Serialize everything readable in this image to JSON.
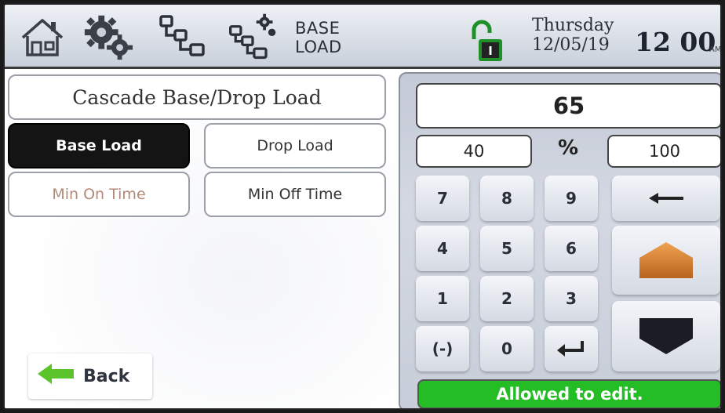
{
  "header": {
    "screen_title_line1": "BASE",
    "screen_title_line2": "LOAD",
    "day": "Thursday",
    "date": "12/05/19",
    "time": "12 00",
    "ampm": "AM",
    "icons": [
      "home-icon",
      "settings-gears-icon",
      "cascade-icon",
      "cascade-settings-icon",
      "unlocked-padlock-icon"
    ]
  },
  "left": {
    "title": "Cascade Base/Drop Load",
    "buttons": {
      "base_load": "Base Load",
      "drop_load": "Drop Load",
      "min_on_time": "Min On Time",
      "min_off_time": "Min Off Time"
    },
    "back": "Back"
  },
  "keypad": {
    "value": "65",
    "min": "40",
    "unit": "%",
    "max": "100",
    "keys": [
      "7",
      "8",
      "9",
      "4",
      "5",
      "6",
      "1",
      "2",
      "3",
      "(-)",
      "0"
    ],
    "status": "Allowed to edit.",
    "colors": {
      "status": "#25bd25",
      "up_arrow": "#e08a3c",
      "active_button": "#141414",
      "back_arrow": "#5bc42a"
    }
  }
}
